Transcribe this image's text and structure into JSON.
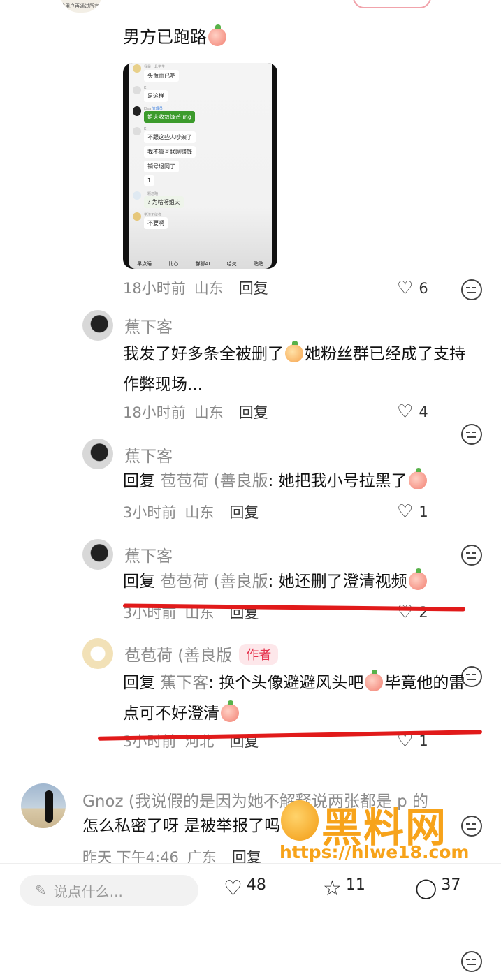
{
  "top": {
    "avatar_tiny_text": "该用户再通过所有考试"
  },
  "post": {
    "text": "男方已跑路",
    "screenshot": {
      "lines": [
        {
          "name": "我是一具学生",
          "msg": "头像而已吧"
        },
        {
          "name": "K",
          "msg": "是这样"
        },
        {
          "name": "Elsa",
          "tag": "管理员",
          "msg": "姐夫收敛锋芒 ing"
        },
        {
          "name": "K",
          "msg": "不跟这些人吵架了"
        },
        {
          "name": "",
          "msg": "我不靠互联网赚钱"
        },
        {
          "name": "",
          "msg": "销号退网了"
        },
        {
          "name": "",
          "msg": "1"
        },
        {
          "name": "一颗忽略",
          "msg": "? 为啥呀姐夫"
        },
        {
          "name": "学渣无缝者",
          "msg": "不要啊"
        }
      ],
      "toolbar": [
        "早点睡",
        "比心",
        "群聊AI",
        "哈欠",
        "贴贴"
      ]
    },
    "time": "18小时前",
    "location": "山东",
    "reply_label": "回复",
    "likes": "6"
  },
  "comments": [
    {
      "user": "蕉下客",
      "text": "我发了好多条全被删了",
      "text2": "她粉丝群已经成了支持作弊现场...",
      "time": "18小时前",
      "location": "山东",
      "reply_label": "回复",
      "likes": "4"
    },
    {
      "user": "蕉下客",
      "prefix": "回复",
      "target": "苞苞荷 (善良版",
      "text": ": 她把我小号拉黑了",
      "time": "3小时前",
      "location": "山东",
      "reply_label": "回复",
      "likes": "1"
    },
    {
      "user": "蕉下客",
      "prefix": "回复",
      "target": "苞苞荷 (善良版",
      "text": ": 她还删了澄清视频",
      "time": "3小时前",
      "location": "山东",
      "reply_label": "回复",
      "likes": "2"
    },
    {
      "user": "苞苞荷 (善良版",
      "badge": "作者",
      "prefix": "回复",
      "target": "蕉下客",
      "text": ": 换个头像避避风头吧",
      "text2": "毕竟他的雷点可不好澄清",
      "time": "3小时前",
      "location": "河北",
      "reply_label": "回复",
      "likes": "1"
    }
  ],
  "gnoz": {
    "user": "Gnoz (我说假的是因为她不解释说两张都是 p 的",
    "text": "怎么私密了呀 是被举报了吗",
    "time": "昨天 下午4:46",
    "location": "广东",
    "reply_label": "回复"
  },
  "watermark": {
    "title": "黑料网",
    "url": "https://hlwe18.com"
  },
  "bottom": {
    "input_placeholder": "说点什么...",
    "likes": "48",
    "stars": "11",
    "comments": "37"
  }
}
